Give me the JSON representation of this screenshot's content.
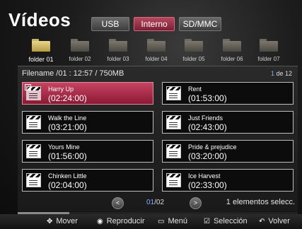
{
  "header": {
    "title": "Vídeos"
  },
  "source_tabs": [
    {
      "label": "USB",
      "active": false
    },
    {
      "label": "Interno",
      "active": true
    },
    {
      "label": "SD/MMC",
      "active": false
    }
  ],
  "folders": [
    {
      "label": "folder 01",
      "active": true
    },
    {
      "label": "folder 02",
      "active": false
    },
    {
      "label": "folder 03",
      "active": false
    },
    {
      "label": "folder 04",
      "active": false
    },
    {
      "label": "folder 05",
      "active": false
    },
    {
      "label": "folder 06",
      "active": false
    },
    {
      "label": "folder 07",
      "active": false
    }
  ],
  "file_info": "Filename /01 : 12:57 / 750MB",
  "page_indicator": {
    "current": "1",
    "rest": " de 12"
  },
  "items": [
    {
      "name": "Harry Up",
      "duration": "(02:24:00)",
      "selected": true,
      "checked": true
    },
    {
      "name": "Rent",
      "duration": "(01:53:00)",
      "selected": false,
      "checked": false
    },
    {
      "name": "Walk the  Line",
      "duration": "(03:21:00)",
      "selected": false,
      "checked": false
    },
    {
      "name": "Just Friends",
      "duration": "(02:43:00)",
      "selected": false,
      "checked": false
    },
    {
      "name": "Yours Mine",
      "duration": "(01:56:00)",
      "selected": false,
      "checked": false
    },
    {
      "name": "Pride & prejudice",
      "duration": "(03:20:00)",
      "selected": false,
      "checked": false
    },
    {
      "name": "Chinken Little",
      "duration": "(02:04:00)",
      "selected": false,
      "checked": false
    },
    {
      "name": "Ice Harvest",
      "duration": "(02:33:00)",
      "selected": false,
      "checked": false
    }
  ],
  "pager": {
    "prev": "<",
    "next": ">",
    "current": "01",
    "rest": "/02"
  },
  "selection_count": "1 elementos selecc.",
  "footer": {
    "move": {
      "icon": "move-icon",
      "label": "Mover"
    },
    "play": {
      "icon": "play-icon",
      "label": "Reproducir"
    },
    "menu": {
      "icon": "menu-icon",
      "label": "Menú"
    },
    "select": {
      "icon": "select-icon",
      "label": "Selección"
    },
    "back": {
      "icon": "back-icon",
      "label": "Volver"
    }
  },
  "colors": {
    "accent": "#b0304f",
    "page_highlight": "#7fb0ff"
  }
}
